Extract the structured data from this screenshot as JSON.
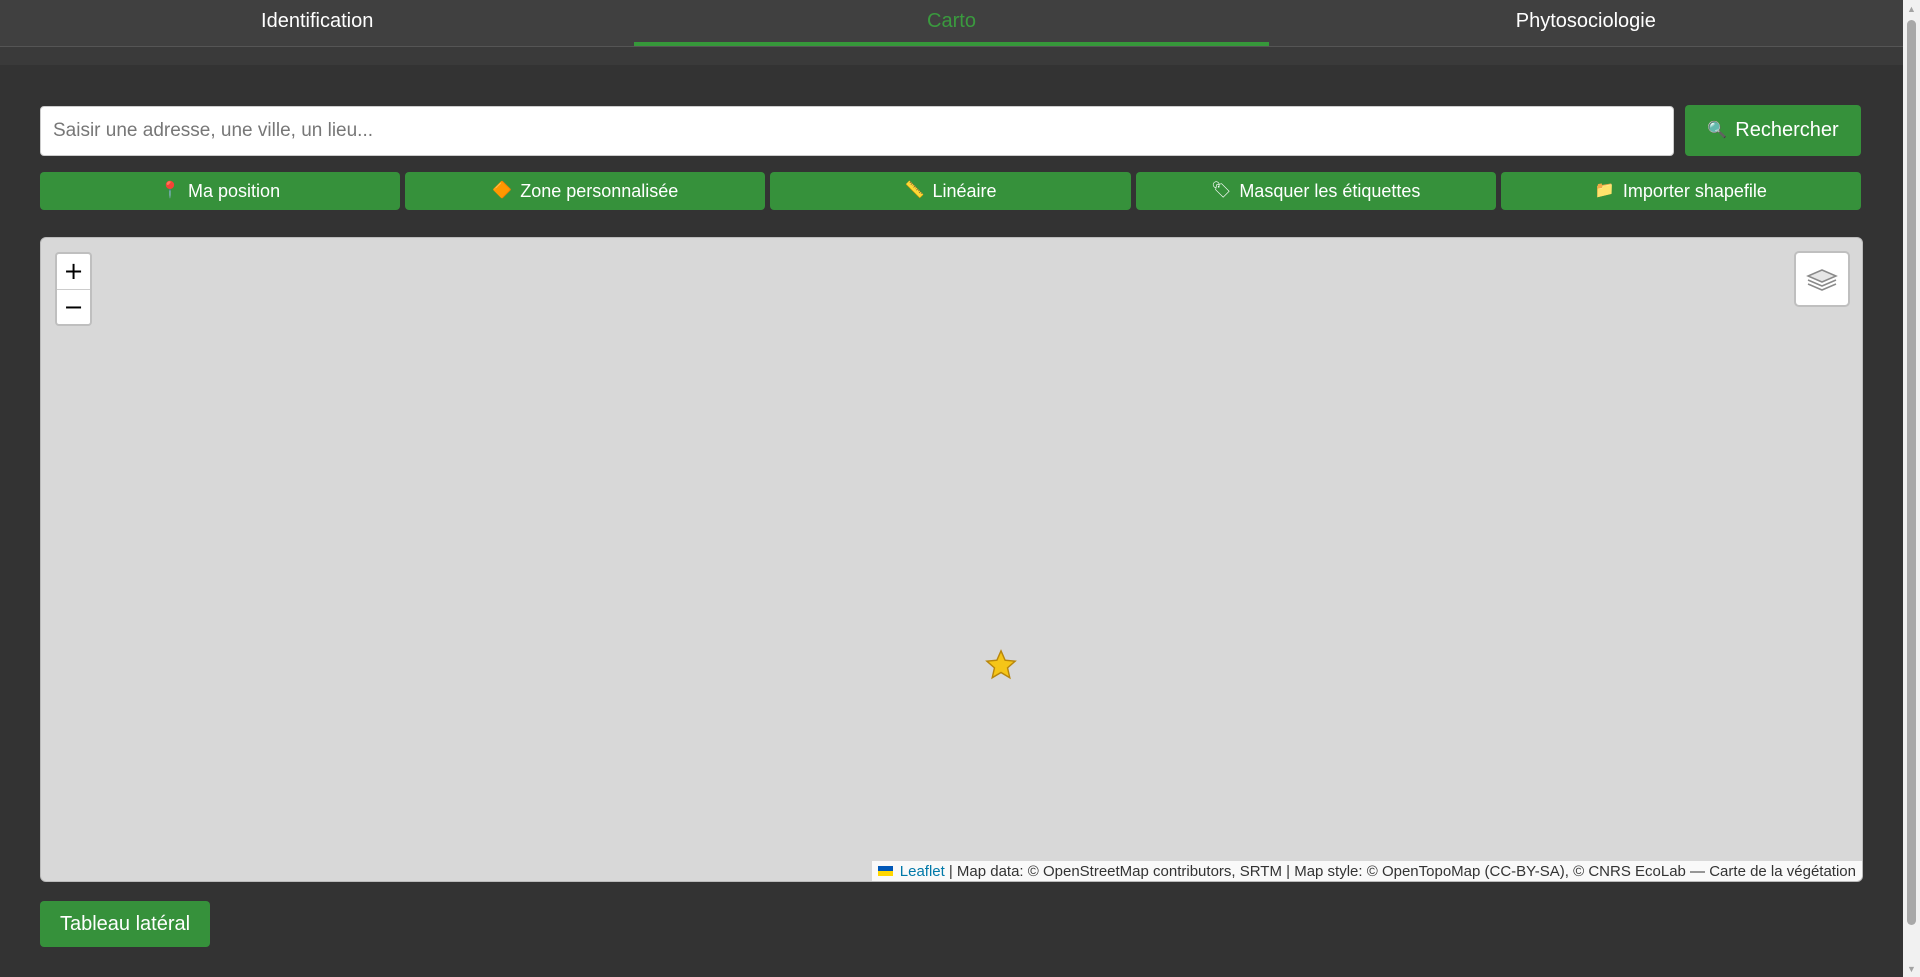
{
  "tabs": [
    {
      "label": "Identification",
      "active": false
    },
    {
      "label": "Carto",
      "active": true
    },
    {
      "label": "Phytosociologie",
      "active": false
    }
  ],
  "search": {
    "placeholder": "Saisir une adresse, une ville, un lieu...",
    "value": "",
    "button_label": "Rechercher",
    "button_icon": "magnifier-icon"
  },
  "tools": [
    {
      "label": "Ma position",
      "icon": "pin-icon"
    },
    {
      "label": "Zone personnalisée",
      "icon": "diamond-icon"
    },
    {
      "label": "Linéaire",
      "icon": "ruler-icon"
    },
    {
      "label": "Masquer les étiquettes",
      "icon": "tag-icon"
    },
    {
      "label": "Importer shapefile",
      "icon": "folder-icon"
    }
  ],
  "map": {
    "zoom_in": "+",
    "zoom_out": "−",
    "marker_icon": "star-icon",
    "attribution": {
      "link": "Leaflet",
      "text": "| Map data: © OpenStreetMap contributors, SRTM | Map style: © OpenTopoMap (CC-BY-SA), © CNRS EcoLab — Carte de la végétation"
    }
  },
  "side_panel_button": "Tableau latéral",
  "colors": {
    "accent_green": "#36913b",
    "active_tab_text": "#3a9a3e",
    "background": "#333333",
    "map_background": "#d8d8d8"
  }
}
